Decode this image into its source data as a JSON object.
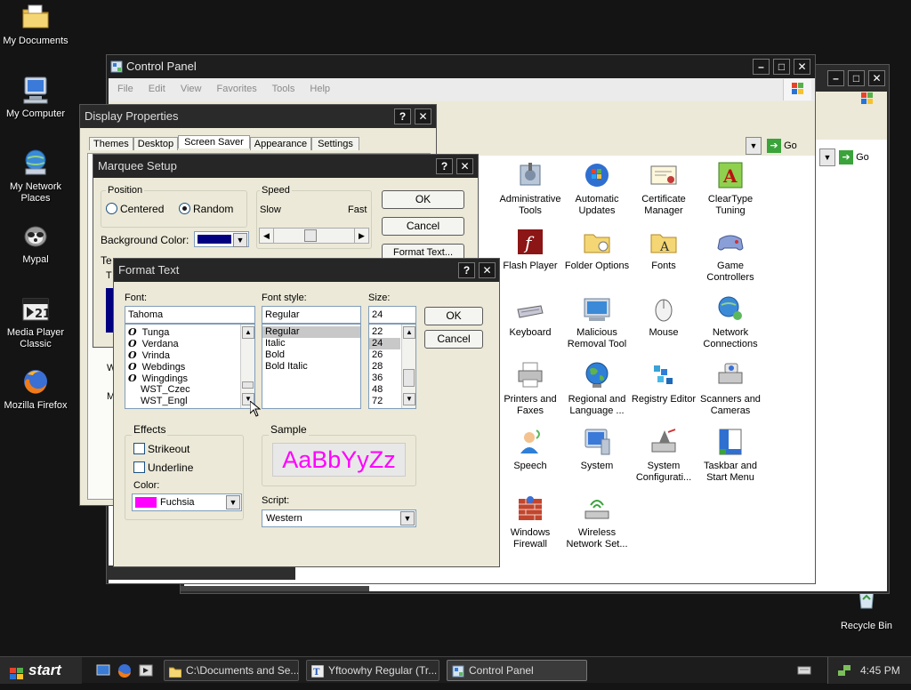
{
  "desktop": {
    "icons": [
      {
        "label": "My Documents",
        "icon": "folder-documents-icon"
      },
      {
        "label": "My Computer",
        "icon": "computer-icon"
      },
      {
        "label": "My Network Places",
        "icon": "network-icon"
      },
      {
        "label": "Mypal",
        "icon": "mypal-browser-icon"
      },
      {
        "label": "Media Player Classic",
        "icon": "media-player-icon"
      },
      {
        "label": "Mozilla Firefox",
        "icon": "firefox-icon"
      },
      {
        "label": "Recycle Bin",
        "icon": "recycle-bin-icon"
      }
    ]
  },
  "control_panel": {
    "title": "Control Panel",
    "menu": [
      "File",
      "Edit",
      "View",
      "Favorites",
      "Tools",
      "Help"
    ],
    "go_label": "Go",
    "items": [
      {
        "label": "Administrative Tools",
        "icon": "admin-tools-icon"
      },
      {
        "label": "Automatic Updates",
        "icon": "windows-update-icon"
      },
      {
        "label": "Certificate Manager",
        "icon": "certificate-icon"
      },
      {
        "label": "ClearType Tuning",
        "icon": "cleartype-icon"
      },
      {
        "label": "Flash Player",
        "icon": "flash-icon"
      },
      {
        "label": "Folder Options",
        "icon": "folder-options-icon"
      },
      {
        "label": "Fonts",
        "icon": "fonts-folder-icon"
      },
      {
        "label": "Game Controllers",
        "icon": "gamepad-icon"
      },
      {
        "label": "Keyboard",
        "icon": "keyboard-icon"
      },
      {
        "label": "Malicious Removal Tool",
        "icon": "removal-tool-icon"
      },
      {
        "label": "Mouse",
        "icon": "mouse-icon"
      },
      {
        "label": "Network Connections",
        "icon": "network-connections-icon"
      },
      {
        "label": "Printers and Faxes",
        "icon": "printer-icon"
      },
      {
        "label": "Regional and Language ...",
        "icon": "globe-icon"
      },
      {
        "label": "Registry Editor",
        "icon": "registry-icon"
      },
      {
        "label": "Scanners and Cameras",
        "icon": "scanner-icon"
      },
      {
        "label": "Speech",
        "icon": "speech-icon"
      },
      {
        "label": "System",
        "icon": "system-icon"
      },
      {
        "label": "System Configurati...",
        "icon": "msconfig-icon"
      },
      {
        "label": "Taskbar and Start Menu",
        "icon": "taskbar-icon"
      },
      {
        "label": "Windows Firewall",
        "icon": "firewall-icon"
      },
      {
        "label": "Wireless Network Set...",
        "icon": "wireless-icon"
      }
    ]
  },
  "display_properties": {
    "title": "Display Properties",
    "tabs": [
      "Themes",
      "Desktop",
      "Screen Saver",
      "Appearance",
      "Settings"
    ],
    "active_tab": "Screen Saver"
  },
  "marquee": {
    "title": "Marquee Setup",
    "position_label": "Position",
    "centered": "Centered",
    "random": "Random",
    "speed_label": "Speed",
    "slow": "Slow",
    "fast": "Fast",
    "bg_color_label": "Background Color:",
    "bg_color": "#000080",
    "ok": "OK",
    "cancel": "Cancel",
    "format_text": "Format Text..."
  },
  "format_text": {
    "title": "Format Text",
    "font_label": "Font:",
    "font_value": "Tahoma",
    "fonts": [
      "Tunga",
      "Verdana",
      "Vrinda",
      "Webdings",
      "Wingdings",
      "WST_Czec",
      "WST_Engl"
    ],
    "style_label": "Font style:",
    "style_value": "Regular",
    "styles": [
      "Regular",
      "Italic",
      "Bold",
      "Bold Italic"
    ],
    "size_label": "Size:",
    "size_value": "24",
    "sizes": [
      "22",
      "24",
      "26",
      "28",
      "36",
      "48",
      "72"
    ],
    "ok": "OK",
    "cancel": "Cancel",
    "effects_label": "Effects",
    "strikeout": "Strikeout",
    "underline": "Underline",
    "color_label": "Color:",
    "color_name": "Fuchsia",
    "color_hex": "#ff00ff",
    "sample_label": "Sample",
    "sample_text": "AaBbYyZz",
    "script_label": "Script:",
    "script_value": "Western"
  },
  "taskbar": {
    "start": "start",
    "tasks": [
      "C:\\Documents and Se...",
      "Yftoowhy Regular (Tr...",
      "Control Panel"
    ],
    "clock": "4:45 PM"
  }
}
